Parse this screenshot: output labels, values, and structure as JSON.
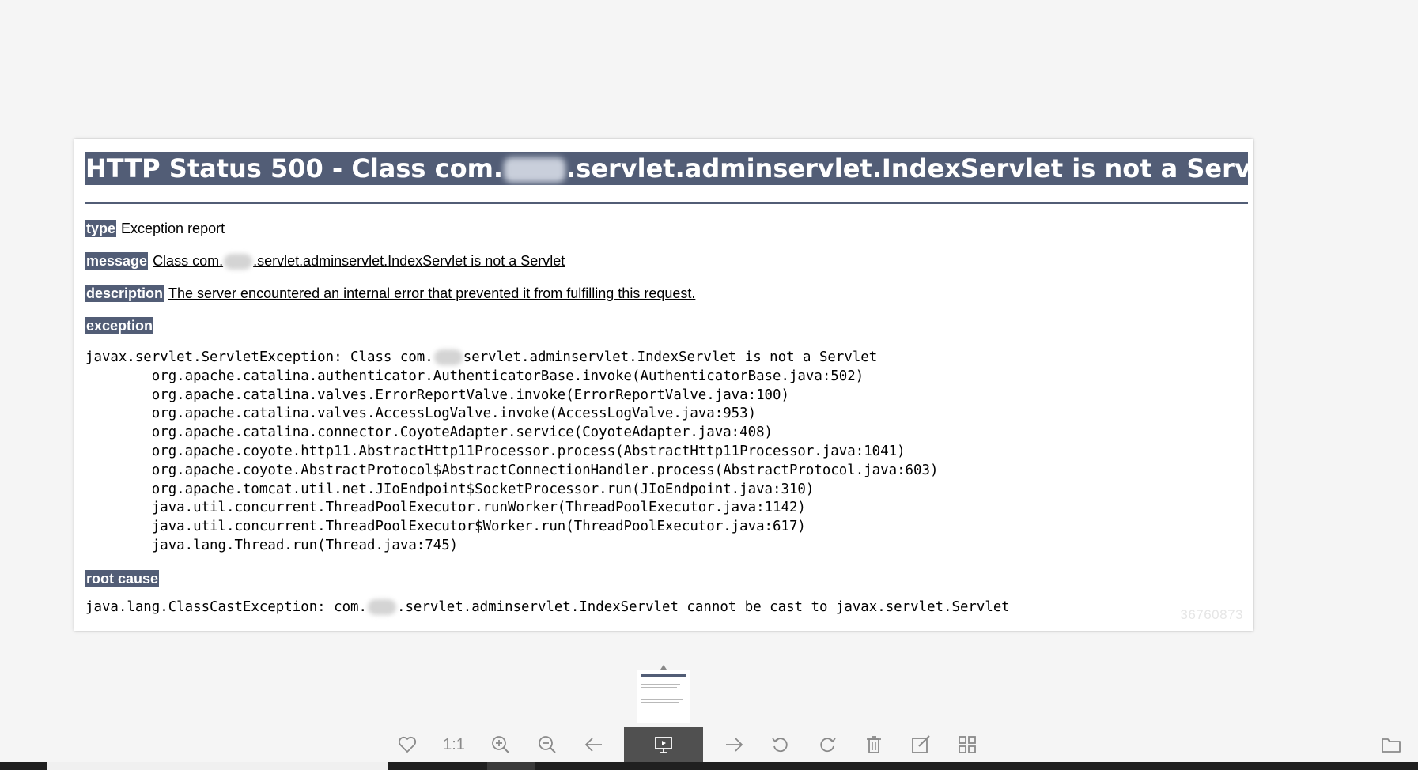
{
  "error_page": {
    "title_prefix": "HTTP Status 500 - Class com.",
    "title_suffix": ".servlet.adminservlet.IndexServlet is not a Servlet",
    "type_label": "type",
    "type_value": "Exception report",
    "message_label": "message",
    "message_prefix": "Class com.",
    "message_suffix": ".servlet.adminservlet.IndexServlet is not a Servlet",
    "description_label": "description",
    "description_value": "The server encountered an internal error that prevented it from fulfilling this request.",
    "exception_label": "exception",
    "exception_first_prefix": "javax.servlet.ServletException: Class com.",
    "exception_first_suffix": "servlet.adminservlet.IndexServlet is not a Servlet",
    "exception_trace": "\torg.apache.catalina.authenticator.AuthenticatorBase.invoke(AuthenticatorBase.java:502)\n\torg.apache.catalina.valves.ErrorReportValve.invoke(ErrorReportValve.java:100)\n\torg.apache.catalina.valves.AccessLogValve.invoke(AccessLogValve.java:953)\n\torg.apache.catalina.connector.CoyoteAdapter.service(CoyoteAdapter.java:408)\n\torg.apache.coyote.http11.AbstractHttp11Processor.process(AbstractHttp11Processor.java:1041)\n\torg.apache.coyote.AbstractProtocol$AbstractConnectionHandler.process(AbstractProtocol.java:603)\n\torg.apache.tomcat.util.net.JIoEndpoint$SocketProcessor.run(JIoEndpoint.java:310)\n\tjava.util.concurrent.ThreadPoolExecutor.runWorker(ThreadPoolExecutor.java:1142)\n\tjava.util.concurrent.ThreadPoolExecutor$Worker.run(ThreadPoolExecutor.java:617)\n\tjava.lang.Thread.run(Thread.java:745)",
    "root_cause_label": "root cause",
    "root_cause_prefix": "java.lang.ClassCastException: com.",
    "root_cause_suffix": ".servlet.adminservlet.IndexServlet cannot be cast to javax.servlet.Servlet",
    "watermark": "36760873"
  },
  "toolbar": {
    "items": [
      {
        "name": "favorite",
        "icon": "heart-icon"
      },
      {
        "name": "actual-size",
        "label": "1:1"
      },
      {
        "name": "zoom-in",
        "icon": "zoom-in-icon"
      },
      {
        "name": "zoom-out",
        "icon": "zoom-out-icon"
      },
      {
        "name": "previous",
        "icon": "arrow-left-icon"
      },
      {
        "name": "slideshow",
        "icon": "slideshow-icon",
        "active": true
      },
      {
        "name": "next",
        "icon": "arrow-right-icon"
      },
      {
        "name": "rotate-left",
        "icon": "rotate-left-icon"
      },
      {
        "name": "rotate-right",
        "icon": "rotate-right-icon"
      },
      {
        "name": "delete",
        "icon": "trash-icon"
      },
      {
        "name": "edit",
        "icon": "edit-icon"
      },
      {
        "name": "grid",
        "icon": "grid-icon"
      },
      {
        "name": "open-folder",
        "icon": "folder-icon"
      }
    ]
  },
  "colors": {
    "tomcat_header": "#525d76",
    "toolbar_active": "#505050",
    "icon": "#8a8a8a"
  }
}
